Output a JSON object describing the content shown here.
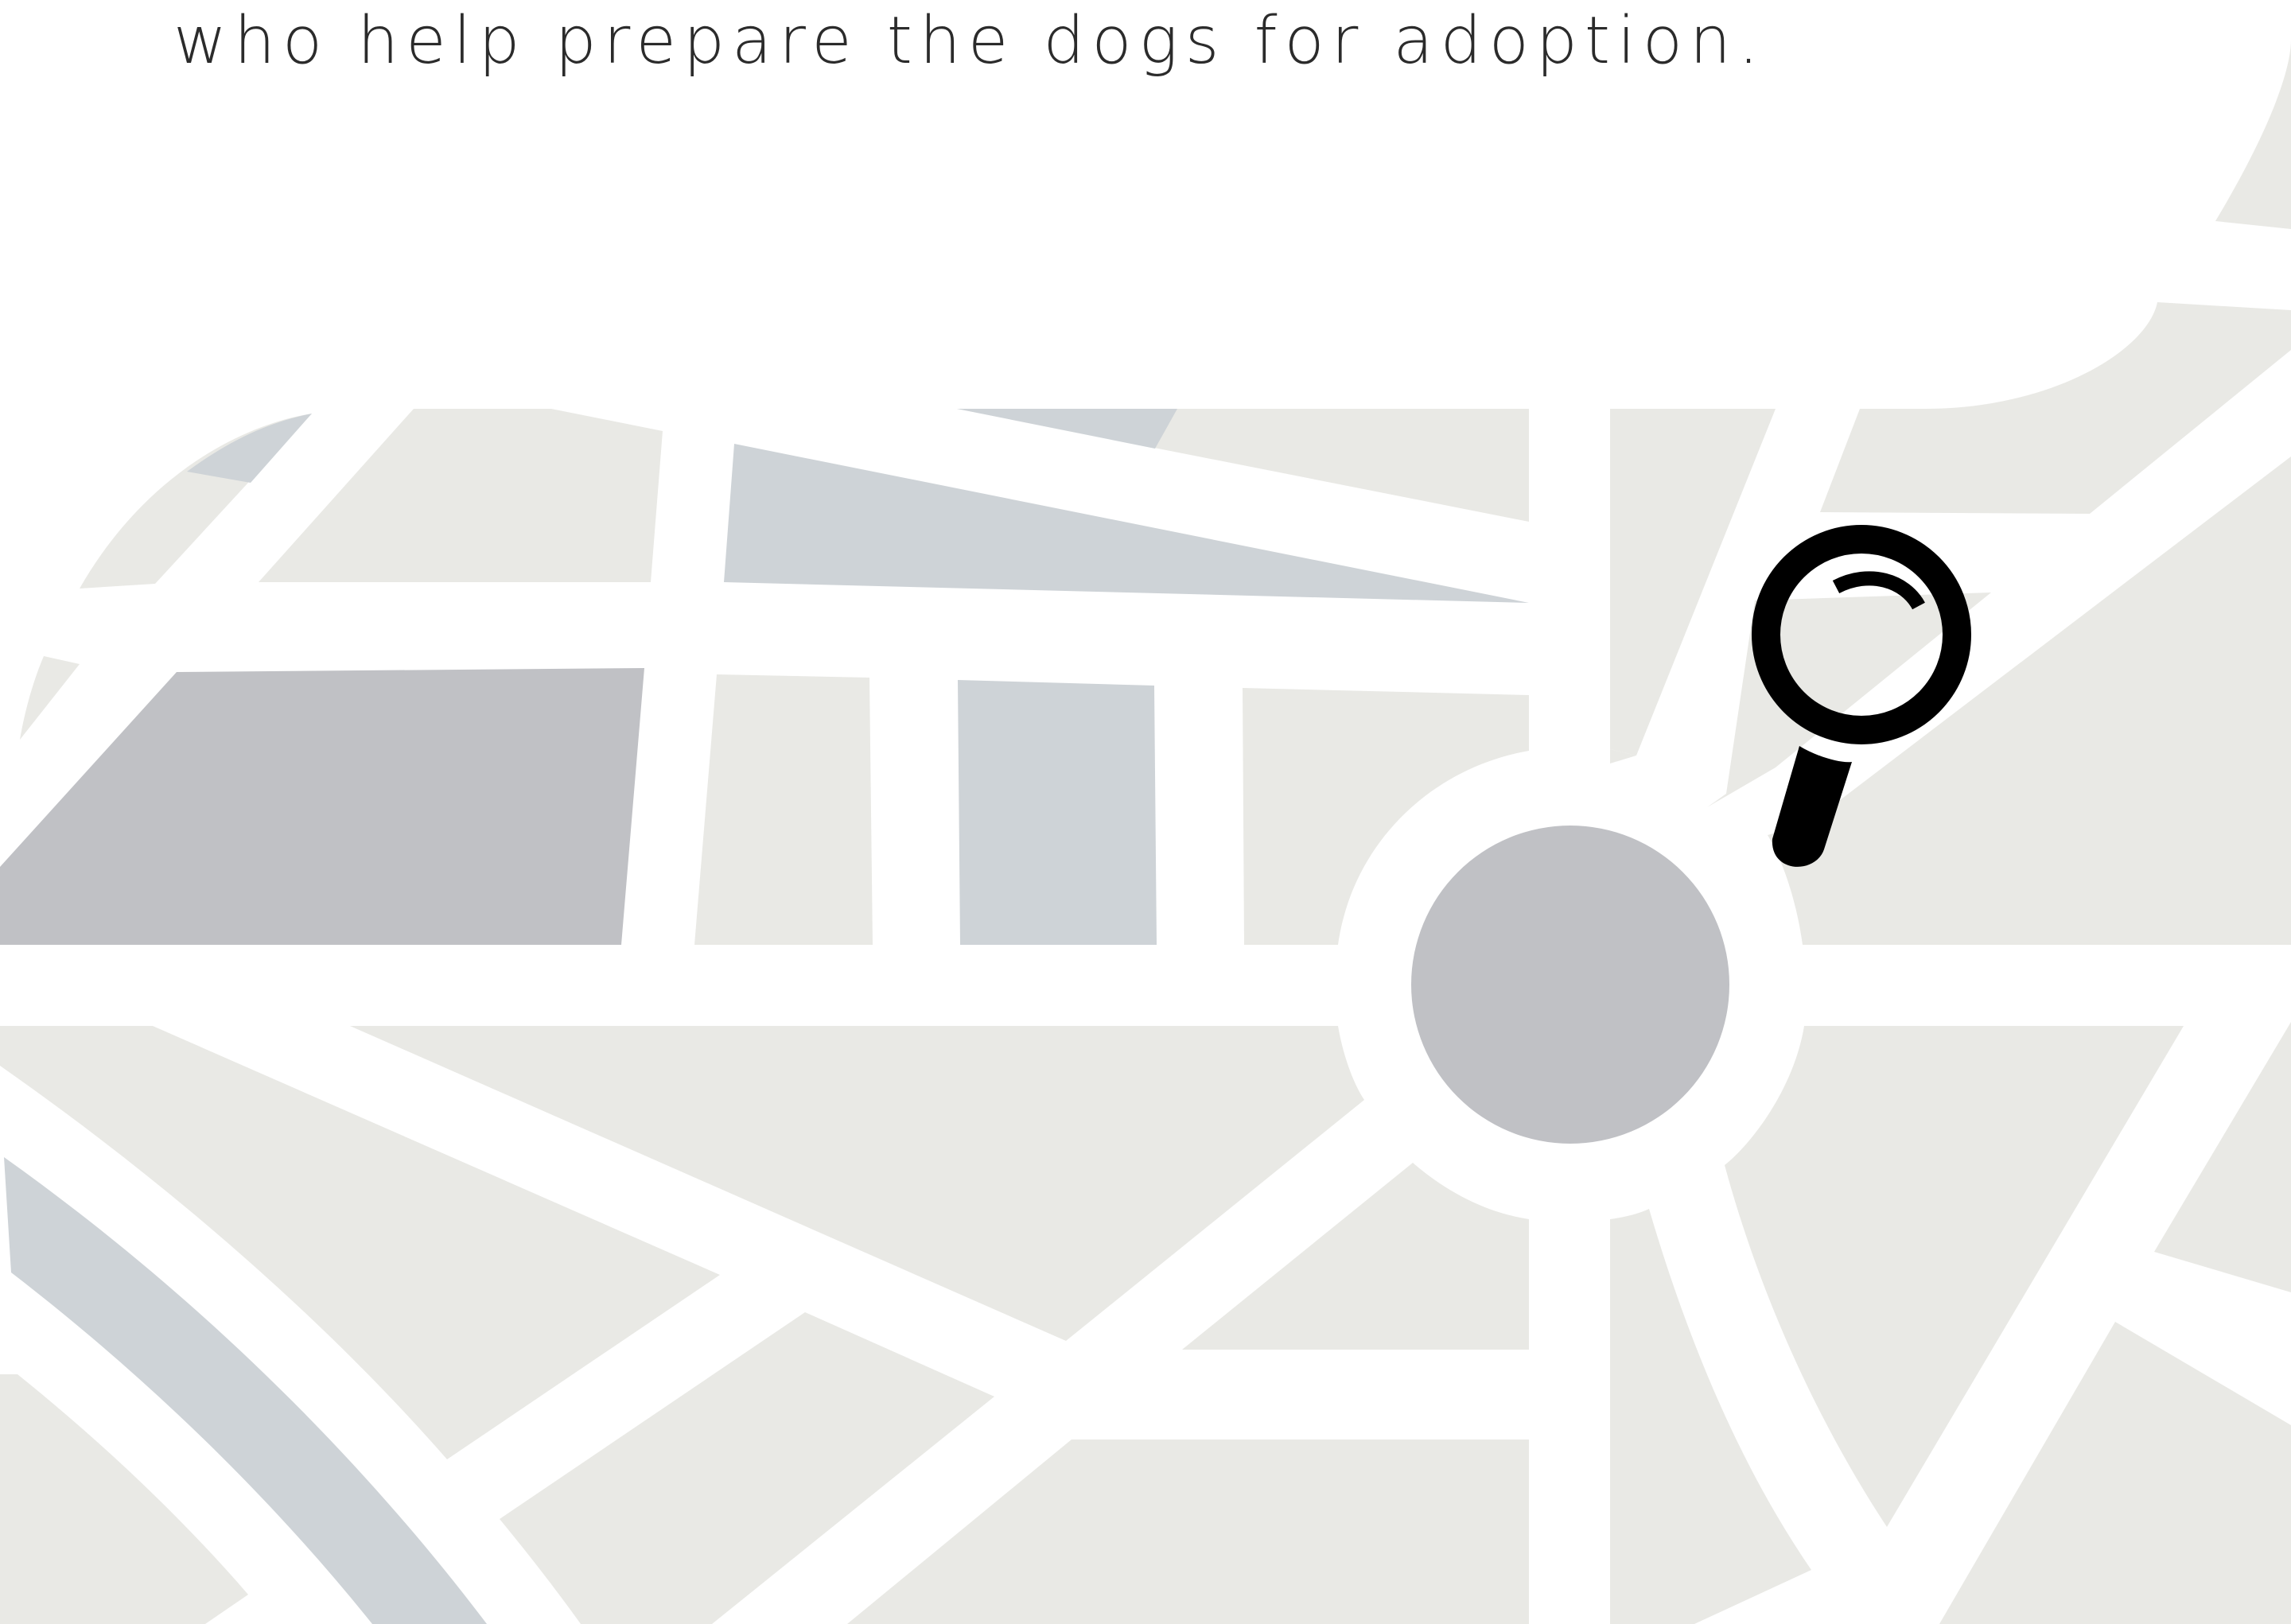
{
  "caption": {
    "text": "who help prepare the dogs for adoption."
  },
  "colors": {
    "block_light": "#e9e9e5",
    "block_blue": "#ced3d7",
    "block_gray": "#c0c1c5",
    "road": "#ffffff",
    "icon": "#000000",
    "text": "#2b2b2b"
  },
  "icons": {
    "search": "magnifying-glass-icon"
  }
}
